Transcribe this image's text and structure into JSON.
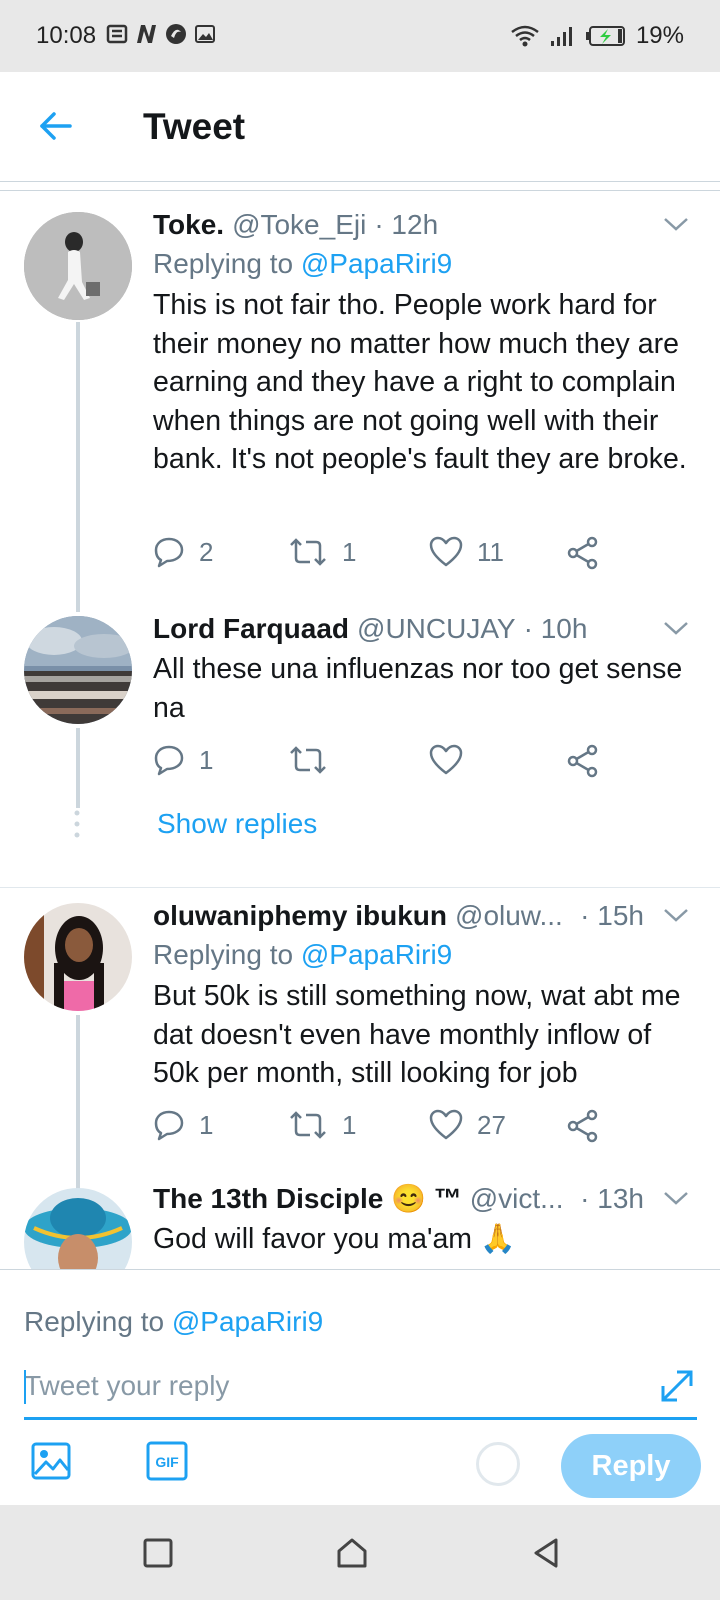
{
  "status_bar": {
    "time": "10:08",
    "battery_percent": "19%",
    "notification_icons": [
      "notes-icon",
      "n-icon",
      "vpn-icon",
      "image-icon"
    ],
    "right_icons": [
      "wifi-icon",
      "signal-icon",
      "battery-charging-icon"
    ]
  },
  "header": {
    "title": "Tweet",
    "back_icon": "arrow-left-icon"
  },
  "colors": {
    "accent": "#1da1f2",
    "secondary_text": "#657786",
    "divider": "#ccd6dd",
    "reply_button_disabled": "#8ed0f9"
  },
  "tweets": [
    {
      "name": "Toke.",
      "handle": "@Toke_Eji",
      "time": "· 12h",
      "replying_prefix": "Replying to",
      "replying_to": "@PapaRiri9",
      "text": "This is not fair tho. People work hard for their money no matter how much they are earning  and they have a right to complain when things are not going well with their bank. It's not people's fault they are broke.",
      "replies": "2",
      "retweets": "1",
      "likes": "11"
    },
    {
      "name": "Lord Farquaad",
      "handle": "@UNCUJAY",
      "time": "· 10h",
      "text": "All these una influenzas nor too get sense na",
      "replies": "1",
      "retweets": "",
      "likes": "",
      "show_replies": "Show replies"
    },
    {
      "name": "oluwaniphemy ibukun",
      "handle": "@oluw...",
      "time": "· 15h",
      "replying_prefix": "Replying to",
      "replying_to": "@PapaRiri9",
      "text": "But 50k is still something now, wat abt me dat doesn't even have monthly inflow of 50k per month, still looking for job",
      "replies": "1",
      "retweets": "1",
      "likes": "27"
    },
    {
      "name": "The 13th Disciple 😊 ™",
      "handle": "@vict...",
      "time": "· 13h",
      "text": "God will favor you ma'am 🙏"
    }
  ],
  "compose": {
    "replying_prefix": "Replying to",
    "replying_to": "@PapaRiri9",
    "placeholder": "Tweet your reply",
    "reply_button": "Reply",
    "tools": [
      "image-icon",
      "gif-icon"
    ]
  },
  "nav_bar": [
    "recent-apps-icon",
    "home-icon",
    "back-icon"
  ]
}
